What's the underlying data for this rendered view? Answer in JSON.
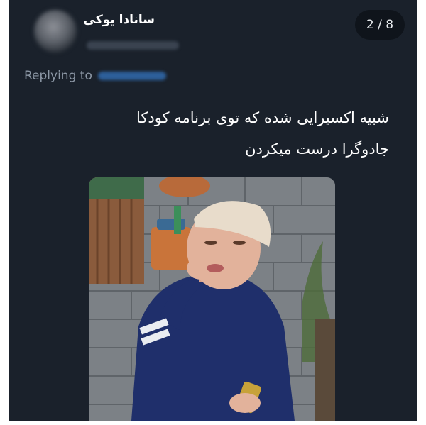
{
  "header": {
    "display_name": "سانادا یوکی",
    "page_counter": "2 / 8"
  },
  "reply": {
    "label": "Replying to"
  },
  "tweet": {
    "lines": [
      "شبیه اکسیرایی شده که توی برنامه کودکا",
      "جادوگرا درست میکردن"
    ]
  },
  "colors": {
    "background": "#1a212b",
    "text": "#ffffff",
    "muted": "#8c97a5",
    "counter_bg": "#0f141b"
  },
  "icons": {
    "avatar": "blurred-avatar"
  }
}
